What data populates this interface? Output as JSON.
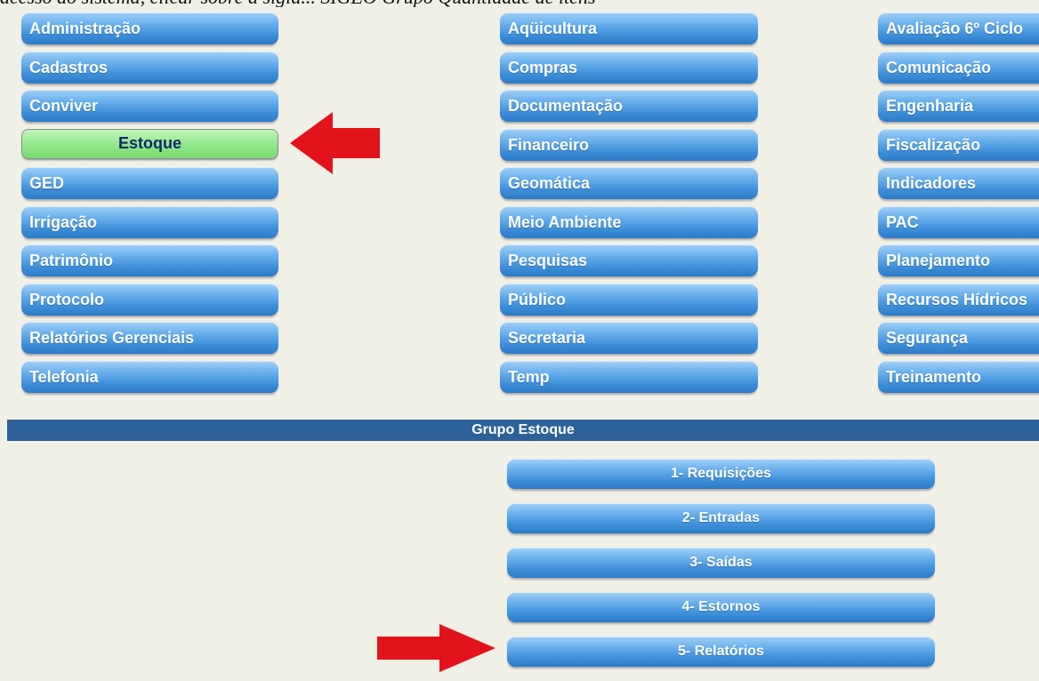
{
  "top_strip_text": "acesso ao sistema, clicar sobre a sigla... SIGEO Grupo Quantidade de itens",
  "menu": {
    "column1": [
      {
        "label": "Administração"
      },
      {
        "label": "Cadastros"
      },
      {
        "label": "Conviver"
      },
      {
        "label": "Estoque",
        "active": true
      },
      {
        "label": "GED"
      },
      {
        "label": "Irrigação"
      },
      {
        "label": "Patrimônio"
      },
      {
        "label": "Protocolo"
      },
      {
        "label": "Relatórios Gerenciais"
      },
      {
        "label": "Telefonia"
      }
    ],
    "column2": [
      {
        "label": "Aqüicultura"
      },
      {
        "label": "Compras"
      },
      {
        "label": "Documentação"
      },
      {
        "label": "Financeiro"
      },
      {
        "label": "Geomática"
      },
      {
        "label": "Meio Ambiente"
      },
      {
        "label": "Pesquisas"
      },
      {
        "label": "Público"
      },
      {
        "label": "Secretaria"
      },
      {
        "label": "Temp"
      }
    ],
    "column3": [
      {
        "label": "Avaliação 6º Ciclo"
      },
      {
        "label": "Comunicação"
      },
      {
        "label": "Engenharia"
      },
      {
        "label": "Fiscalização"
      },
      {
        "label": "Indicadores"
      },
      {
        "label": "PAC"
      },
      {
        "label": "Planejamento"
      },
      {
        "label": "Recursos Hídricos"
      },
      {
        "label": "Segurança"
      },
      {
        "label": "Treinamento"
      }
    ]
  },
  "group": {
    "title": "Grupo Estoque",
    "items": [
      {
        "label": "1- Requisições"
      },
      {
        "label": "2- Entradas"
      },
      {
        "label": "3- Saídas"
      },
      {
        "label": "4- Estornos"
      },
      {
        "label": "5- Relatórios"
      }
    ]
  },
  "colors": {
    "page_background": "#f1f0e7",
    "button_blue": "#4a98e0",
    "button_active_green": "#94e88c",
    "active_text": "#102a6b",
    "group_bar": "#2e6199",
    "arrow_red": "#e3131b"
  },
  "icons": {
    "left_arrow": "red-arrow-left-icon",
    "right_arrow": "red-arrow-right-icon"
  }
}
